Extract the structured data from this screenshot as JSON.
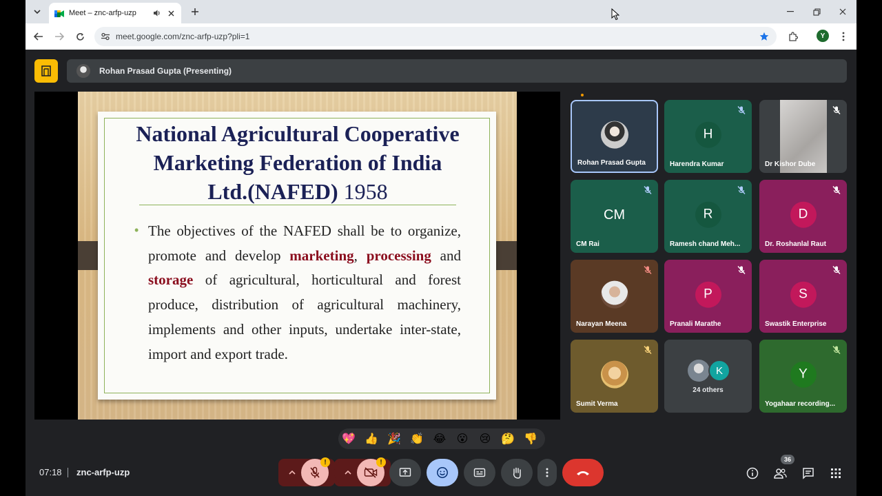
{
  "browser": {
    "tab_title": "Meet – znc-arfp-uzp",
    "url": "meet.google.com/znc-arfp-uzp?pli=1",
    "profile_initial": "Y"
  },
  "meet": {
    "presenting_label": "Rohan Prasad Gupta (Presenting)",
    "clock": "07:18",
    "meeting_code": "znc-arfp-uzp",
    "participant_count": "36"
  },
  "slide": {
    "title_line1": "National Agricultural Cooperative",
    "title_line2": "Marketing Federation of India",
    "title_line3": "Ltd.(NAFED)",
    "title_year": "1958",
    "body_part1": "The objectives of the NAFED shall be to organize, promote and develop ",
    "kw_marketing": "marketing",
    "body_part2": ", ",
    "kw_processing": "processing",
    "body_part3": " and ",
    "kw_storage": "storage",
    "body_part4": " of agricultural, horticultural and forest produce, distribution of agricultural machinery, implements and other inputs, undertake inter-state, import and export trade."
  },
  "participants": [
    {
      "name": "Rohan Prasad Gupta"
    },
    {
      "name": "Harendra Kumar",
      "initial": "H"
    },
    {
      "name": "Dr Kishor Dube"
    },
    {
      "name": "CM Rai",
      "initial": "CM"
    },
    {
      "name": "Ramesh chand Meh...",
      "initial": "R"
    },
    {
      "name": "Dr. Roshanlal Raut",
      "initial": "D"
    },
    {
      "name": "Narayan Meena"
    },
    {
      "name": "Pranali Marathe",
      "initial": "P"
    },
    {
      "name": "Swastik Enterprise",
      "initial": "S"
    },
    {
      "name": "Sumit Verma"
    },
    {
      "name": "24 others",
      "initial": "K"
    },
    {
      "name": "Yogahaar recording...",
      "initial": "Y"
    }
  ],
  "reactions": [
    "💖",
    "👍",
    "🎉",
    "👏",
    "😂",
    "😮",
    "😢",
    "🤔",
    "👎"
  ],
  "colors": {
    "meet_bg": "#202124",
    "leave_red": "#dc362e",
    "slide_title": "#1b2156",
    "keyword_red": "#8b0e1e",
    "accent_green": "#8db25a"
  }
}
